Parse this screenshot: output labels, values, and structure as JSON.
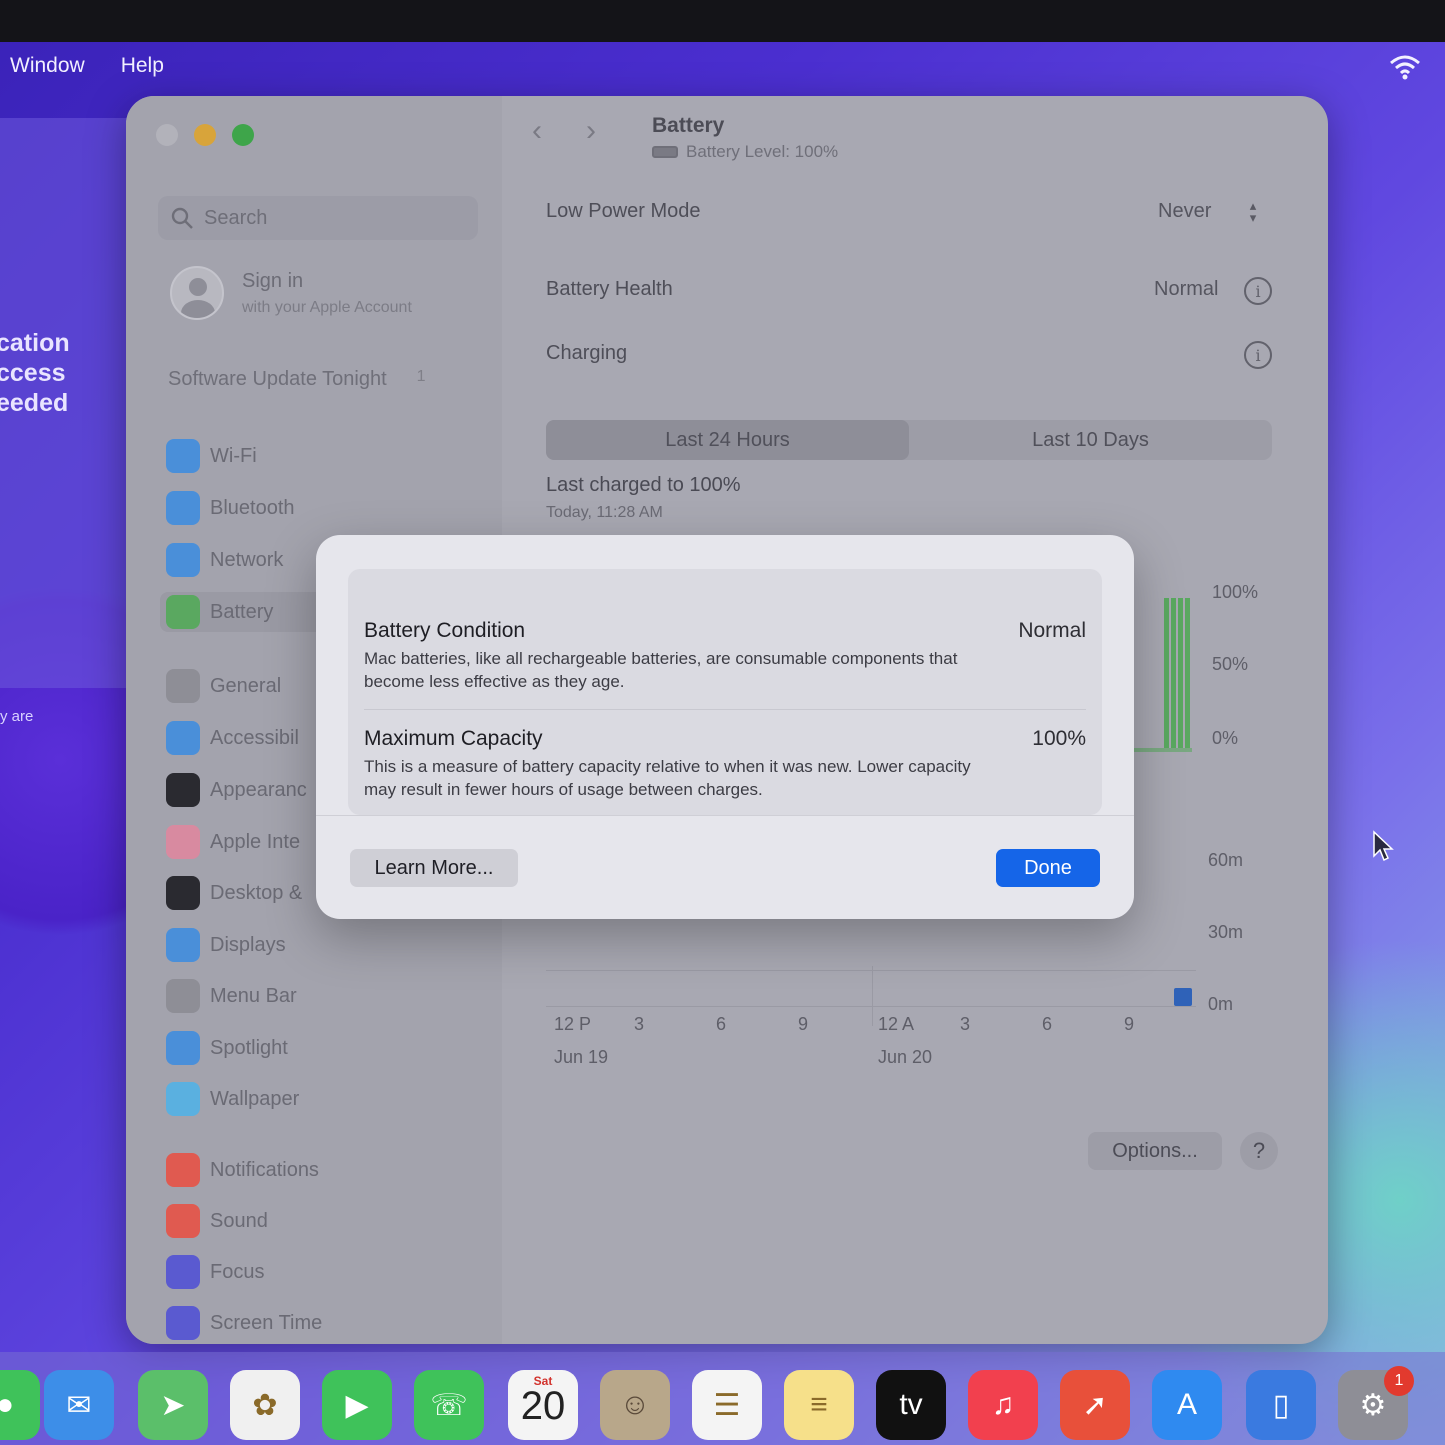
{
  "menubar": {
    "items": [
      "Window",
      "Help"
    ]
  },
  "background_window": {
    "text_lines": [
      "cation",
      "ccess",
      "eeded"
    ],
    "small_text": "y are"
  },
  "window": {
    "sidebar": {
      "search_placeholder": "Search",
      "signin": {
        "title": "Sign in",
        "subtitle": "with your Apple Account"
      },
      "software_update": {
        "label": "Software Update Tonight",
        "badge": "1"
      },
      "items": [
        {
          "label": "Wi-Fi",
          "icon": "wifi-icon",
          "color": "#4a8fd9"
        },
        {
          "label": "Bluetooth",
          "icon": "bluetooth-icon",
          "color": "#4a8fd9"
        },
        {
          "label": "Network",
          "icon": "globe-icon",
          "color": "#4a8fd9"
        },
        {
          "label": "Battery",
          "icon": "battery-icon",
          "color": "#5aa860"
        },
        {
          "label": "General",
          "icon": "gear-icon",
          "color": "#8e8e96"
        },
        {
          "label": "Accessibil",
          "icon": "accessibility-icon",
          "color": "#4a8fd9"
        },
        {
          "label": "Appearanc",
          "icon": "appearance-icon",
          "color": "#2a2a30"
        },
        {
          "label": "Apple Inte",
          "icon": "apple-intelligence-icon",
          "color": "#d88aa0"
        },
        {
          "label": "Desktop &",
          "icon": "desktop-icon",
          "color": "#2a2a30"
        },
        {
          "label": "Displays",
          "icon": "sun-icon",
          "color": "#4a8fd9"
        },
        {
          "label": "Menu Bar",
          "icon": "menubar-icon",
          "color": "#8e8e96"
        },
        {
          "label": "Spotlight",
          "icon": "magnifier-icon",
          "color": "#4a8fd9"
        },
        {
          "label": "Wallpaper",
          "icon": "flower-icon",
          "color": "#5ab0e0"
        },
        {
          "label": "Notifications",
          "icon": "bell-icon",
          "color": "#e05a50"
        },
        {
          "label": "Sound",
          "icon": "speaker-icon",
          "color": "#e05a50"
        },
        {
          "label": "Focus",
          "icon": "moon-icon",
          "color": "#5a5ad0"
        },
        {
          "label": "Screen Time",
          "icon": "hourglass-icon",
          "color": "#5a5ad0"
        }
      ],
      "selected": "Battery"
    },
    "header": {
      "title": "Battery",
      "subtitle": "Battery Level: 100%"
    },
    "rows": {
      "low_power": {
        "label": "Low Power Mode",
        "value": "Never"
      },
      "health": {
        "label": "Battery Health",
        "value": "Normal"
      },
      "charging": {
        "label": "Charging"
      }
    },
    "segments": [
      "Last 24 Hours",
      "Last 10 Days"
    ],
    "last_charged": {
      "title": "Last charged to 100%",
      "time": "Today, 11:28 AM"
    },
    "chart_data": {
      "type": "bar",
      "level_axis_ticks": [
        "100%",
        "50%",
        "0%"
      ],
      "usage_axis_ticks": [
        "60m",
        "30m",
        "0m"
      ],
      "x_tick_labels": [
        "12 P",
        "3",
        "6",
        "9",
        "12 A",
        "3",
        "6",
        "9"
      ],
      "date_labels": [
        "Jun 19",
        "Jun 20"
      ],
      "battery_level_series": {
        "color": "#5aa860",
        "values": [
          100,
          100,
          100,
          100
        ]
      },
      "screen_usage_series": {
        "color": "#2f62b8",
        "values": [
          1
        ]
      }
    },
    "footer": {
      "options_label": "Options...",
      "help_label": "?"
    }
  },
  "modal": {
    "condition": {
      "title": "Battery Condition",
      "value": "Normal",
      "description": "Mac batteries, like all rechargeable batteries, are consumable components that become less effective as they age."
    },
    "capacity": {
      "title": "Maximum Capacity",
      "value": "100%",
      "description": "This is a measure of battery capacity relative to when it was new. Lower capacity may result in fewer hours of usage between charges."
    },
    "learn_more_label": "Learn More...",
    "done_label": "Done"
  },
  "dock": {
    "calendar": {
      "day": "Sat",
      "date": "20"
    },
    "settings_badge": "1",
    "apps": [
      {
        "name": "messages-icon",
        "color": "#3fc25a"
      },
      {
        "name": "mail-icon",
        "color": "#3d8ee8"
      },
      {
        "name": "maps-icon",
        "color": "#5bbf6a"
      },
      {
        "name": "photos-icon",
        "color": "#f0f0f0"
      },
      {
        "name": "facetime-icon",
        "color": "#3fc25a"
      },
      {
        "name": "phone-icon",
        "color": "#3fc25a"
      },
      {
        "name": "calendar-icon",
        "color": "#f4f4f4"
      },
      {
        "name": "contacts-icon",
        "color": "#b8a78a"
      },
      {
        "name": "reminders-icon",
        "color": "#f4f4f4"
      },
      {
        "name": "notes-icon",
        "color": "#f6e08a"
      },
      {
        "name": "tv-icon",
        "color": "#111111"
      },
      {
        "name": "music-icon",
        "color": "#f2404e"
      },
      {
        "name": "launchpad-icon",
        "color": "#e8503a"
      },
      {
        "name": "app-store-icon",
        "color": "#2f8af0"
      },
      {
        "name": "iphone-mirroring-icon",
        "color": "#3a7ae0"
      },
      {
        "name": "system-settings-icon",
        "color": "#8e8e96"
      }
    ]
  }
}
